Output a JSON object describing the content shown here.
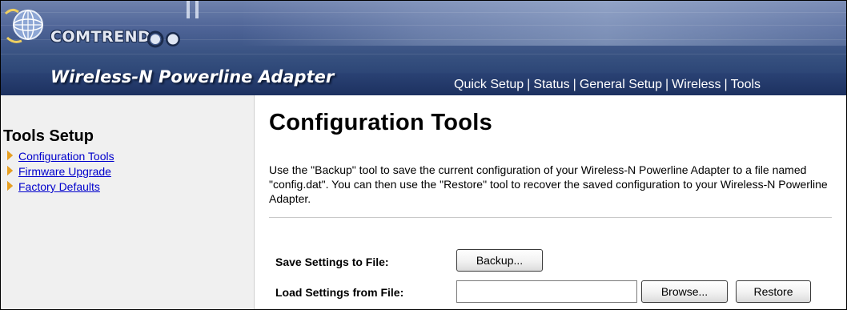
{
  "header": {
    "brand": "COMTREND",
    "product_title": "Wireless-N Powerline Adapter",
    "nav": [
      {
        "label": "Quick Setup"
      },
      {
        "label": "Status"
      },
      {
        "label": "General Setup"
      },
      {
        "label": "Wireless"
      },
      {
        "label": "Tools"
      }
    ],
    "nav_separator": "|"
  },
  "sidebar": {
    "title": "Tools Setup",
    "items": [
      {
        "label": "Configuration Tools"
      },
      {
        "label": "Firmware Upgrade"
      },
      {
        "label": "Factory Defaults"
      }
    ]
  },
  "main": {
    "title": "Configuration Tools",
    "description": "Use the \"Backup\" tool to save the current configuration of your Wireless-N Powerline Adapter to a file named \"config.dat\". You can then use the \"Restore\" tool to recover the saved configuration to your Wireless-N Powerline Adapter.",
    "save_label": "Save Settings to File:",
    "backup_button": "Backup...",
    "load_label": "Load Settings from File:",
    "file_value": "",
    "browse_button": "Browse...",
    "restore_button": "Restore"
  },
  "colors": {
    "header_dark": "#20386a",
    "link": "#0000cc",
    "sidebar_bg": "#f0f0f0",
    "bullet": "#e8a020"
  }
}
